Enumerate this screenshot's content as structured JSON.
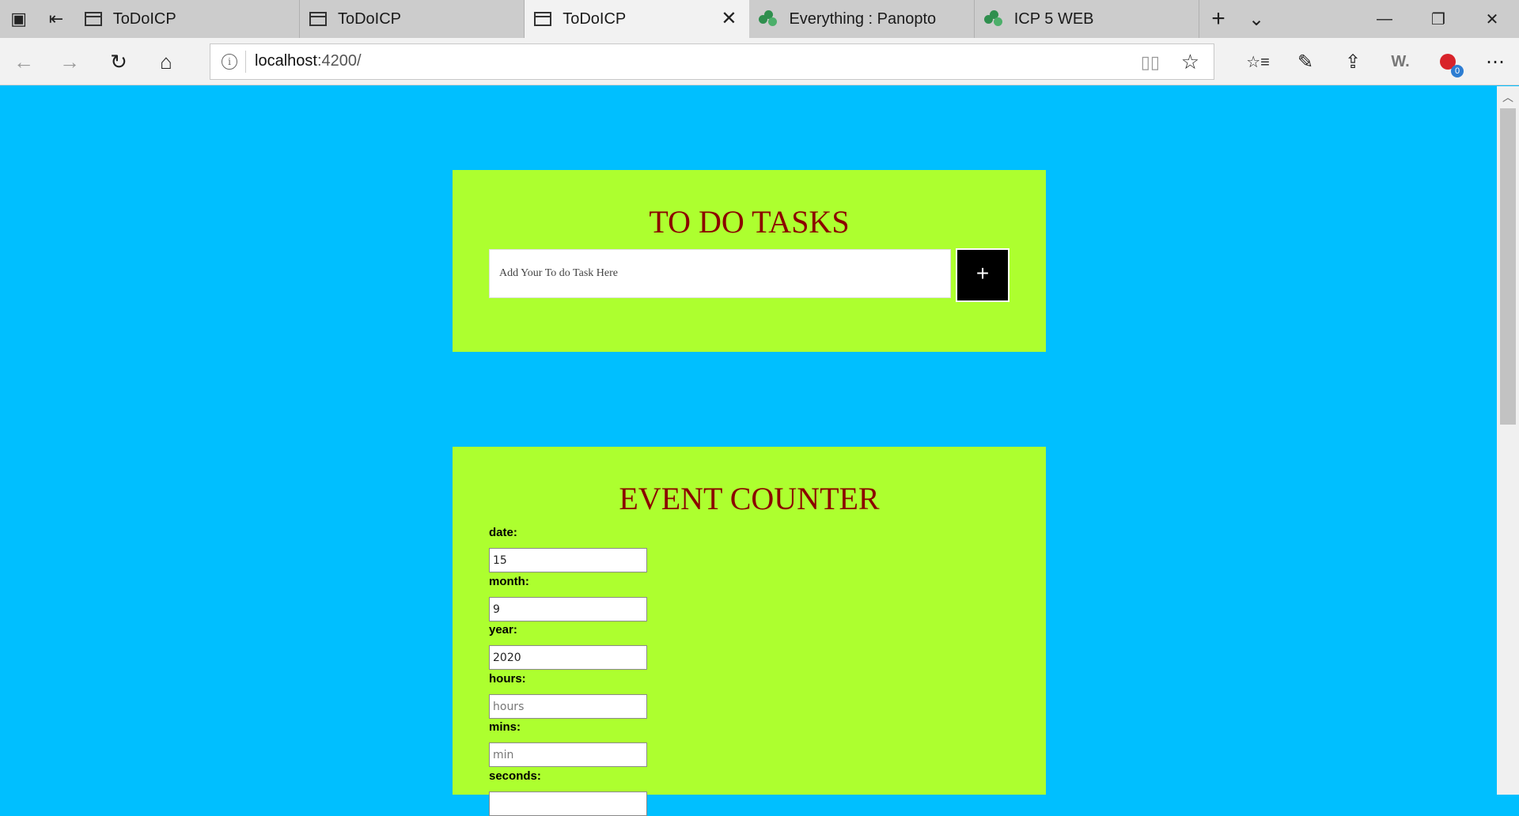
{
  "browser": {
    "tabs": [
      {
        "title": "ToDoICP",
        "icon": "page-icon",
        "active": false
      },
      {
        "title": "ToDoICP",
        "icon": "page-icon",
        "active": false
      },
      {
        "title": "ToDoICP",
        "icon": "page-icon",
        "active": true
      },
      {
        "title": "Everything : Panopto",
        "icon": "panopto-icon",
        "active": false
      },
      {
        "title": "ICP 5 WEB",
        "icon": "panopto-icon",
        "active": false
      }
    ],
    "address": {
      "host": "localhost",
      "path": ":4200/"
    },
    "extension_badge": "0",
    "w_label": "W."
  },
  "icons": {
    "tab_actions": "▣",
    "tab_aside": "⇤",
    "close": "✕",
    "new_tab": "+",
    "tab_list": "⌄",
    "minimize": "—",
    "restore": "❐",
    "win_close": "✕",
    "back": "←",
    "forward": "→",
    "refresh": "↻",
    "home": "⌂",
    "info": "i",
    "reader": "▯▯",
    "favorite": "☆",
    "favorites_list": "☆≡",
    "pen": "✎",
    "share": "⇪",
    "more": "⋯",
    "scroll_up": "︿"
  },
  "todo": {
    "title": "TO DO TASKS",
    "input_placeholder": "Add Your To do Task Here",
    "add_label": "+"
  },
  "event": {
    "title": "EVENT COUNTER",
    "fields": [
      {
        "label": "date:",
        "value": "15",
        "placeholder": ""
      },
      {
        "label": "month:",
        "value": "9",
        "placeholder": ""
      },
      {
        "label": "year:",
        "value": "2020",
        "placeholder": ""
      },
      {
        "label": "hours:",
        "value": "",
        "placeholder": "hours"
      },
      {
        "label": "mins:",
        "value": "",
        "placeholder": "min"
      },
      {
        "label": "seconds:",
        "value": "",
        "placeholder": ""
      }
    ]
  },
  "colors": {
    "page_background": "#00BFFF",
    "panel_background": "#ADFF2F",
    "title_color": "#8B0000",
    "add_button": "#000000"
  }
}
